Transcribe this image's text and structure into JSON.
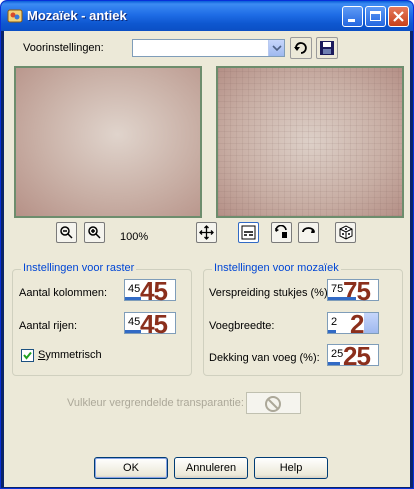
{
  "window": {
    "title": "Mozaïek - antiek",
    "colors": {
      "titlebar": "#0e57d0",
      "client": "#ece9d8",
      "accent_number": "#8b2f1c",
      "group_title": "#0046d5"
    }
  },
  "presets": {
    "label": "Voorinstellingen:",
    "value": ""
  },
  "zoom": {
    "level": "100%"
  },
  "raster": {
    "title": "Instellingen voor raster",
    "columns": {
      "label": "Aantal kolommen:",
      "value": "45"
    },
    "rows": {
      "label": "Aantal rijen:",
      "value": "45"
    },
    "symmetric": {
      "label": "Symmetrisch",
      "checked": true
    }
  },
  "mosaic": {
    "title": "Instellingen voor mozaïek",
    "spread": {
      "label": "Verspreiding stukjes (%):",
      "value": "75"
    },
    "grout_width": {
      "label": "Voegbreedte:",
      "value": "2"
    },
    "grout_coverage": {
      "label": "Dekking van voeg (%):",
      "value": "25"
    }
  },
  "transparency": {
    "label": "Vulkleur vergrendelde transparantie:"
  },
  "buttons": {
    "ok": "OK",
    "cancel": "Annuleren",
    "help": "Help"
  },
  "icons": [
    "app-icon",
    "minimize-icon",
    "maximize-icon",
    "close-icon",
    "dropdown-arrow-icon",
    "load-preset-icon",
    "save-preset-icon",
    "zoom-out-icon",
    "zoom-in-icon",
    "move-icon",
    "proof-icon",
    "reset-icon",
    "randomize-icon",
    "dice-icon",
    "no-symbol-icon"
  ]
}
